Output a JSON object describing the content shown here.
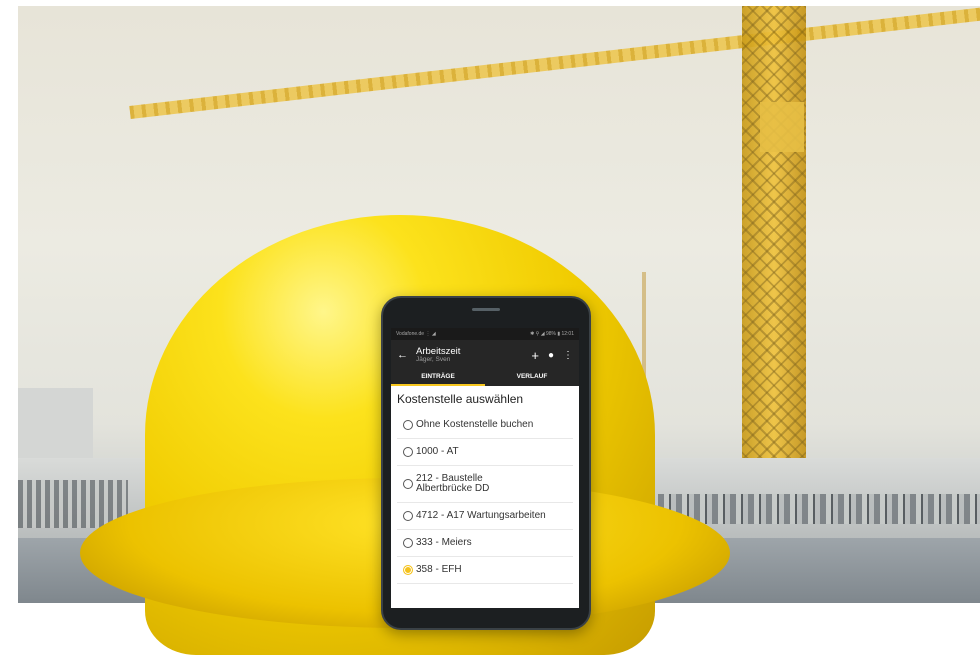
{
  "colors": {
    "accent": "#f7c71f",
    "appbar": "#262626"
  },
  "status_bar": {
    "carrier": "Vodafone.de ⋮ ◢",
    "indicators": "✱ ⚲ ◢ 98% ▮ 12:01"
  },
  "app_bar": {
    "back_icon": "arrow-left-icon",
    "title": "Arbeitszeit",
    "subtitle": "Jäger, Sven",
    "actions": [
      {
        "name": "add-icon",
        "glyph": "+"
      },
      {
        "name": "person-icon",
        "glyph": "👤"
      },
      {
        "name": "more-vert-icon",
        "glyph": "⋮"
      }
    ]
  },
  "tabs": [
    {
      "label": "EINTRÄGE",
      "active": true
    },
    {
      "label": "VERLAUF",
      "active": false
    }
  ],
  "list": {
    "title": "Kostenstelle auswählen",
    "items": [
      {
        "label": "Ohne Kostenstelle buchen",
        "selected": false
      },
      {
        "label": "1000 - AT",
        "selected": false
      },
      {
        "label": "212 - Baustelle Albertbrücke DD",
        "selected": false
      },
      {
        "label": "4712 - A17 Wartungsarbeiten",
        "selected": false
      },
      {
        "label": "333 - Meiers",
        "selected": false
      },
      {
        "label": "358 - EFH",
        "selected": true
      }
    ]
  }
}
